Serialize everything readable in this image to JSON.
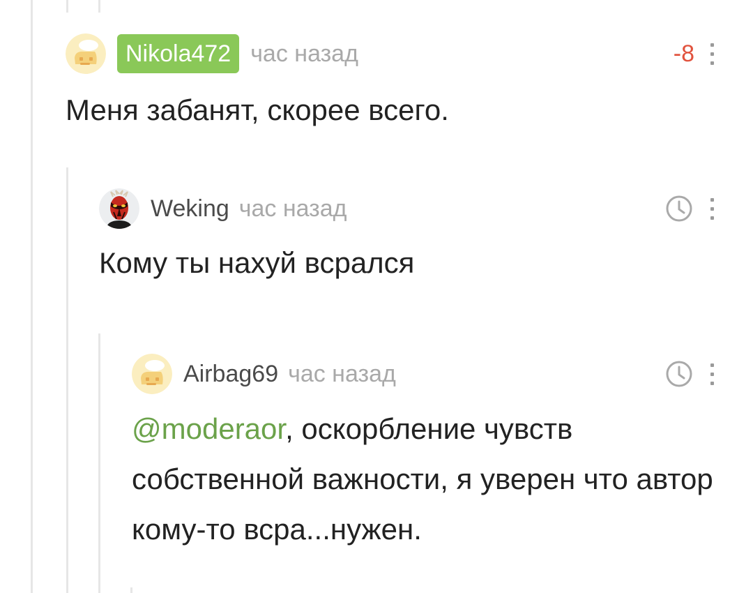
{
  "comments": [
    {
      "username": "Nikola472",
      "time": "час назад",
      "rating": "-8",
      "text": "Меня забанят, скорее всего."
    },
    {
      "username": "Weking",
      "time": "час назад",
      "text": "Кому ты нахуй всрался"
    },
    {
      "username": "Airbag69",
      "time": "час назад",
      "mention": "@moderaor",
      "text": ", оскорбление чувств собственной важности, я уверен что автор кому-то всра...нужен."
    }
  ],
  "colors": {
    "badge": "#8ac858",
    "rating_negative": "#e1523d",
    "mention": "#6ba24a",
    "muted": "#a9a9a9"
  },
  "icons": [
    "default-avatar-icon",
    "darth-maul-avatar-icon",
    "clock-icon",
    "more-vertical-icon"
  ]
}
